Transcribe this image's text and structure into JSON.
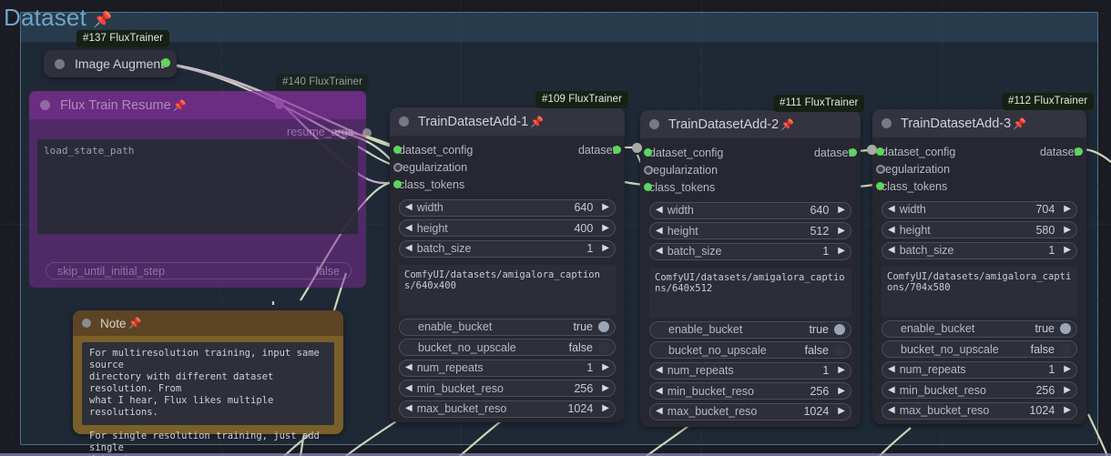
{
  "group": {
    "title": "Dataset",
    "pin": "📌"
  },
  "badges": [
    {
      "label": "#137 FluxTrainer"
    },
    {
      "label": "#140 FluxTrainer"
    },
    {
      "label": "#109 FluxTrainer"
    },
    {
      "label": "#111 FluxTrainer"
    },
    {
      "label": "#112 FluxTrainer"
    }
  ],
  "image_augment": {
    "title": "Image Augment"
  },
  "flux_train_resume": {
    "title": "Flux Train Resume",
    "pin": "📌",
    "output_label": "resume_args",
    "text_placeholder": "load_state_path",
    "widget": {
      "name": "skip_until_initial_step",
      "value": "false"
    }
  },
  "note": {
    "title": "Note",
    "pin": "📌",
    "text": "For multiresolution training, input same source\ndirectory with different dataset resolution. From\nwhat I hear, Flux likes multiple resolutions.\n\nFor single resolution training, just add single\ndataset."
  },
  "nodes": [
    {
      "title": "TrainDatasetAdd-1",
      "pin": "📌",
      "inputs": [
        {
          "label": "dataset_config",
          "port": "green"
        },
        {
          "label": "regularization",
          "port": "ring"
        },
        {
          "label": "class_tokens",
          "port": "green"
        }
      ],
      "output": {
        "label": "dataset",
        "port": "green"
      },
      "widgets_top": [
        {
          "name": "width",
          "value": "640"
        },
        {
          "name": "height",
          "value": "400"
        },
        {
          "name": "batch_size",
          "value": "1"
        }
      ],
      "text": "ComfyUI/datasets/amigalora_captions/640x400",
      "toggles": [
        {
          "name": "enable_bucket",
          "value": "true",
          "state": "on"
        },
        {
          "name": "bucket_no_upscale",
          "value": "false",
          "state": "off"
        }
      ],
      "widgets_bottom": [
        {
          "name": "num_repeats",
          "value": "1"
        },
        {
          "name": "min_bucket_reso",
          "value": "256"
        },
        {
          "name": "max_bucket_reso",
          "value": "1024"
        }
      ]
    },
    {
      "title": "TrainDatasetAdd-2",
      "pin": "📌",
      "inputs": [
        {
          "label": "dataset_config",
          "port": "green"
        },
        {
          "label": "regularization",
          "port": "ring"
        },
        {
          "label": "class_tokens",
          "port": "green"
        }
      ],
      "output": {
        "label": "dataset",
        "port": "green"
      },
      "widgets_top": [
        {
          "name": "width",
          "value": "640"
        },
        {
          "name": "height",
          "value": "512"
        },
        {
          "name": "batch_size",
          "value": "1"
        }
      ],
      "text": "ComfyUI/datasets/amigalora_captions/640x512",
      "toggles": [
        {
          "name": "enable_bucket",
          "value": "true",
          "state": "on"
        },
        {
          "name": "bucket_no_upscale",
          "value": "false",
          "state": "off"
        }
      ],
      "widgets_bottom": [
        {
          "name": "num_repeats",
          "value": "1"
        },
        {
          "name": "min_bucket_reso",
          "value": "256"
        },
        {
          "name": "max_bucket_reso",
          "value": "1024"
        }
      ]
    },
    {
      "title": "TrainDatasetAdd-3",
      "pin": "📌",
      "inputs": [
        {
          "label": "dataset_config",
          "port": "green"
        },
        {
          "label": "regularization",
          "port": "ring"
        },
        {
          "label": "class_tokens",
          "port": "green"
        }
      ],
      "output": {
        "label": "dataset",
        "port": "green"
      },
      "widgets_top": [
        {
          "name": "width",
          "value": "704"
        },
        {
          "name": "height",
          "value": "580"
        },
        {
          "name": "batch_size",
          "value": "1"
        }
      ],
      "text": "ComfyUI/datasets/amigalora_captions/704x580",
      "toggles": [
        {
          "name": "enable_bucket",
          "value": "true",
          "state": "on"
        },
        {
          "name": "bucket_no_upscale",
          "value": "false",
          "state": "off"
        }
      ],
      "widgets_bottom": [
        {
          "name": "num_repeats",
          "value": "1"
        },
        {
          "name": "min_bucket_reso",
          "value": "256"
        },
        {
          "name": "max_bucket_reso",
          "value": "1024"
        }
      ]
    }
  ],
  "colors": {
    "wire_green": "#cdd6b8",
    "wire_purple": "#c9a8cc",
    "port_green": "#5cd65c",
    "group_border": "#78afd2",
    "group_title": "#6ea4c8",
    "note_bg": "#7a5f2b",
    "resume_bg": "#7e2a96"
  }
}
